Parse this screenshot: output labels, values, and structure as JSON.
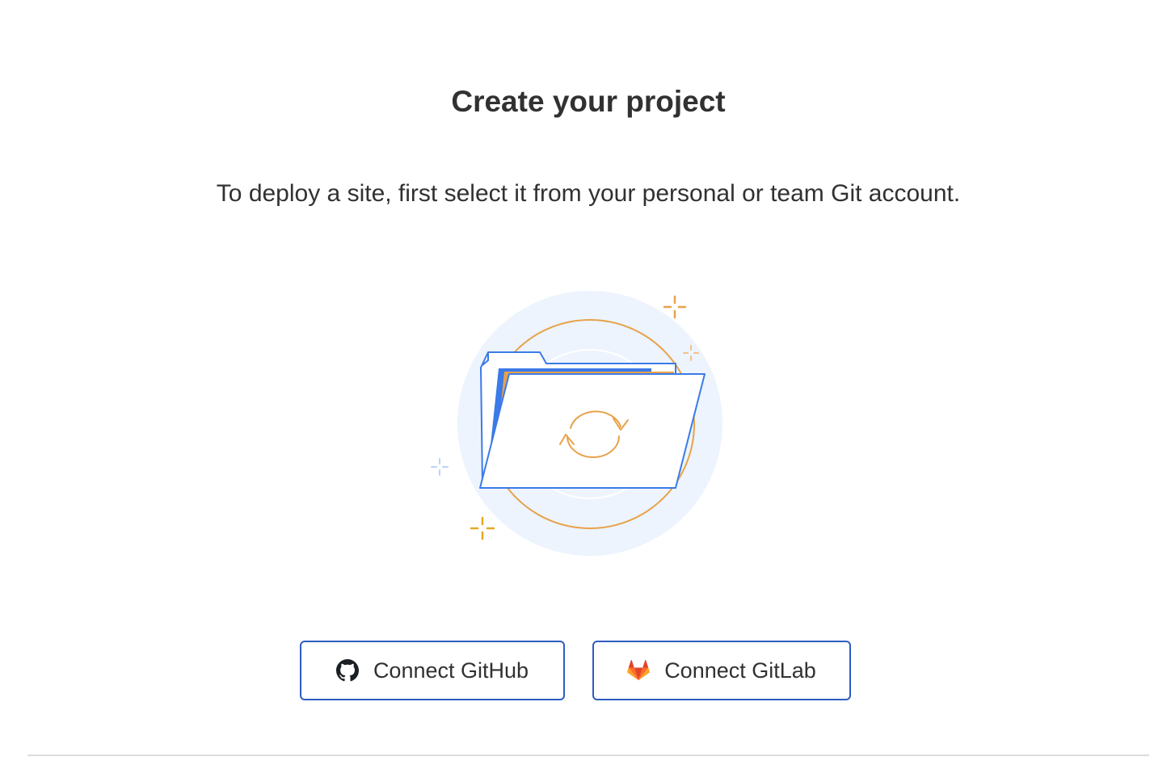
{
  "heading": {
    "title": "Create your project",
    "subtitle": "To deploy a site, first select it from your personal or team Git account."
  },
  "illustration": {
    "icon": "folder-sync-icon",
    "accent_blue": "#3b7ae8",
    "accent_orange": "#e8a24a",
    "circle_bg": "#edf4fd"
  },
  "actions": {
    "github": {
      "label": "Connect GitHub",
      "icon": "github-icon"
    },
    "gitlab": {
      "label": "Connect GitLab",
      "icon": "gitlab-icon"
    }
  },
  "colors": {
    "button_border": "#2f5cc2",
    "text": "#313131",
    "divider": "#dcdcdc"
  }
}
